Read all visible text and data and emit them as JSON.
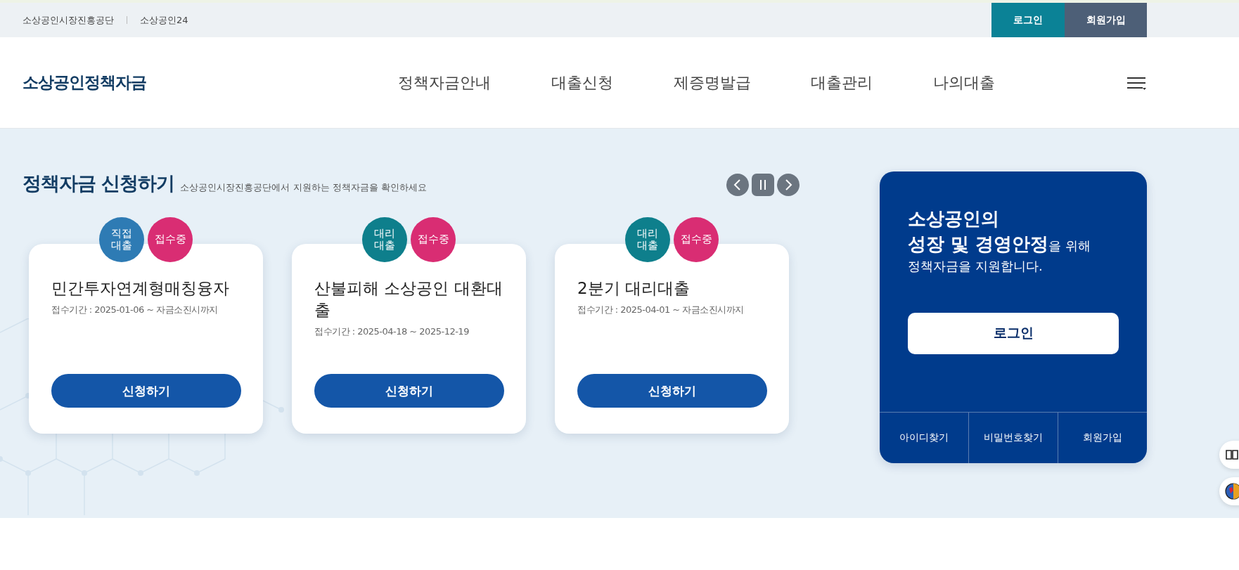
{
  "top_bar": {
    "links": [
      "소상공인시장진흥공단",
      "소상공인24"
    ],
    "buttons": [
      {
        "label": "로그인",
        "kind": "login"
      },
      {
        "label": "회원가입",
        "kind": "join"
      }
    ]
  },
  "header": {
    "logo": "소상공인정책자금",
    "nav": [
      "정책자금안내",
      "대출신청",
      "제증명발급",
      "대출관리",
      "나의대출"
    ]
  },
  "section": {
    "title": "정책자금 신청하기",
    "subtitle": "소상공인시장진흥공단에서 지원하는 정책자금을 확인하세요",
    "cards": [
      {
        "type_badge": {
          "label": "직접 대출",
          "color": "#2e7bb4"
        },
        "status_badge": {
          "label": "접수중",
          "color": "#d92d73"
        },
        "title": "민간투자연계형매칭융자",
        "period": "접수기간 : 2025-01-06 ~ 자금소진시까지",
        "button": "신청하기"
      },
      {
        "type_badge": {
          "label": "대리 대출",
          "color": "#0e7f8c"
        },
        "status_badge": {
          "label": "접수중",
          "color": "#d92d73"
        },
        "title": "산불피해 소상공인 대환대출",
        "period": "접수기간 : 2025-04-18 ~ 2025-12-19",
        "button": "신청하기"
      },
      {
        "type_badge": {
          "label": "대리 대출",
          "color": "#0e7f8c"
        },
        "status_badge": {
          "label": "접수중",
          "color": "#d92d73"
        },
        "title": "2분기 대리대출",
        "period": "접수기간 : 2025-04-01 ~ 자금소진시까지",
        "button": "신청하기"
      }
    ]
  },
  "login_panel": {
    "headline": [
      "**소상공인의**",
      "**성장 및 경영안정**을 위해",
      "정책자금을 지원합니다."
    ],
    "button": "로그인",
    "links": [
      "아이디찾기",
      "비밀번호찾기",
      "회원가입"
    ]
  }
}
